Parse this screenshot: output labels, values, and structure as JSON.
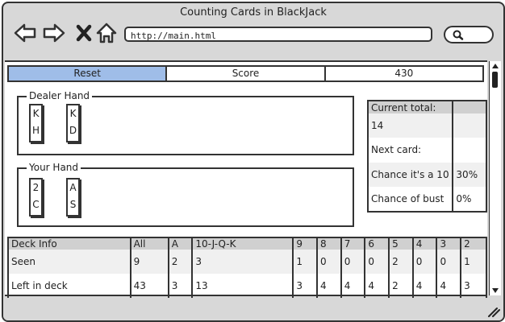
{
  "window": {
    "title": "Counting Cards in BlackJack",
    "url": "http://main.html"
  },
  "tabs": [
    {
      "label": "Reset"
    },
    {
      "label": "Score"
    },
    {
      "label": "430"
    }
  ],
  "dealer": {
    "label": "Dealer Hand",
    "cards": [
      {
        "rank": "K",
        "suit": "H"
      },
      {
        "rank": "K",
        "suit": "D"
      }
    ]
  },
  "player": {
    "label": "Your Hand",
    "cards": [
      {
        "rank": "2",
        "suit": "C"
      },
      {
        "rank": "A",
        "suit": "S"
      }
    ]
  },
  "stats": {
    "rows": [
      {
        "label": "Current total:",
        "value": ""
      },
      {
        "label": "14",
        "value": ""
      },
      {
        "label": "Next card:",
        "value": ""
      },
      {
        "label": "Chance it's a 10",
        "value": "30%"
      },
      {
        "label": "Chance of bust",
        "value": "0%"
      }
    ]
  },
  "deck": {
    "headers": [
      "Deck Info",
      "All",
      "A",
      "10-J-Q-K",
      "9",
      "8",
      "7",
      "6",
      "5",
      "4",
      "3",
      "2"
    ],
    "seen": [
      "Seen",
      "9",
      "2",
      "3",
      "1",
      "0",
      "0",
      "0",
      "2",
      "0",
      "0",
      "1"
    ],
    "left": [
      "Left in deck",
      "43",
      "3",
      "13",
      "3",
      "4",
      "4",
      "4",
      "2",
      "4",
      "4",
      "3"
    ]
  }
}
